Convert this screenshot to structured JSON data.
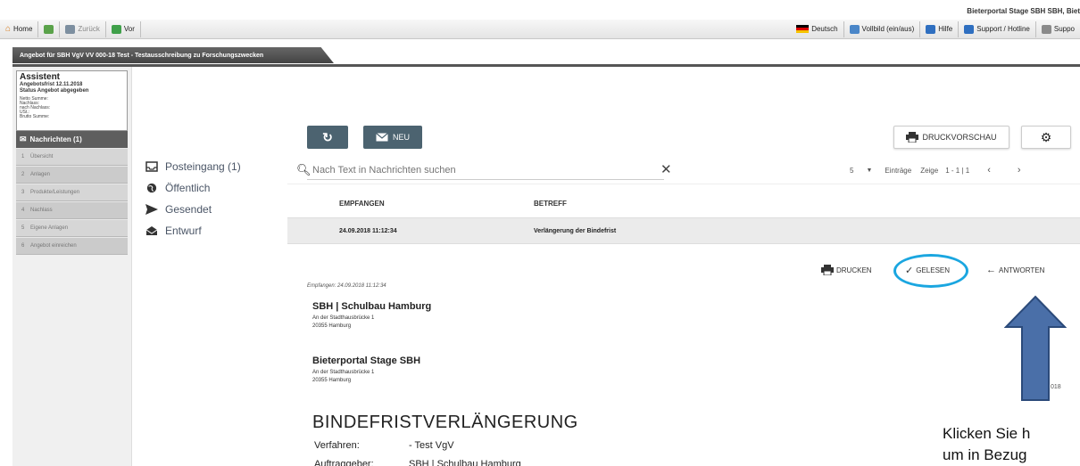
{
  "portal_title": "Bieterportal Stage SBH SBH, Biet",
  "toolbar": {
    "home": "Home",
    "back": "Zurück",
    "forward": "Vor",
    "language": "Deutsch",
    "fullscreen": "Vollbild (ein/aus)",
    "help": "Hilfe",
    "support_hotline": "Support / Hotline",
    "support_cut": "Suppo"
  },
  "tab": {
    "label": "Angebot für SBH VgV VV 000-18 Test - Testausschreibung zu Forschungszwecken"
  },
  "assistant": {
    "title": "Assistent",
    "deadline": "Angebotsfrist 12.11.2018",
    "status": "Status Angebot abgegeben",
    "summary_lines": [
      "Netto Summe:",
      "Nachlass:",
      "nach Nachlass:",
      "USt.:",
      "Brutto Summe:"
    ],
    "messages_label": "Nachrichten (1)",
    "steps": [
      {
        "num": "1",
        "label": "Übersicht"
      },
      {
        "num": "2",
        "label": "Anlagen"
      },
      {
        "num": "3",
        "label": "Produkte/Leistungen"
      },
      {
        "num": "4",
        "label": "Nachlass"
      },
      {
        "num": "5",
        "label": "Eigene Anlagen"
      },
      {
        "num": "6",
        "label": "Angebot einreichen"
      }
    ]
  },
  "buttons": {
    "new": "NEU",
    "print_preview": "DRUCKVORSCHAU"
  },
  "mail_nav": {
    "inbox": "Posteingang (1)",
    "public": "Öffentlich",
    "sent": "Gesendet",
    "draft": "Entwurf"
  },
  "search": {
    "placeholder": "Nach Text in Nachrichten suchen"
  },
  "pager": {
    "page_size": "5",
    "entries_label": "Einträge",
    "show_label": "Zeige",
    "range": "1 - 1 | 1"
  },
  "table": {
    "col_received": "EMPFANGEN",
    "col_subject": "BETREFF",
    "rows": [
      {
        "received": "24.09.2018 11:12:34",
        "subject": "Verlängerung der Bindefrist"
      }
    ]
  },
  "detail": {
    "print": "DRUCKEN",
    "read": "GELESEN",
    "reply": "ANTWORTEN",
    "received_meta": "Empfangen: 24.09.2018 11:12:34",
    "sender": {
      "name": "SBH | Schulbau Hamburg",
      "street": "An der Stadthausbrücke 1",
      "city": "20355 Hamburg"
    },
    "recipient": {
      "name": "Bieterportal Stage SBH",
      "street": "An der Stadthausbrücke 1",
      "city": "20355 Hamburg"
    },
    "year_fragment": "018",
    "doc_title": "BINDEFRISTVERLÄNGERUNG",
    "fields": [
      {
        "key": "Verfahren:",
        "value": "- Test VgV"
      },
      {
        "key": "Auftraggeber:",
        "value": "SBH | Schulbau Hamburg"
      }
    ]
  },
  "annotation": {
    "line1": "Klicken Sie h",
    "line2": "um in Bezug",
    "circle_color": "#1aa6e0",
    "arrow_color": "#4a6fa8"
  }
}
